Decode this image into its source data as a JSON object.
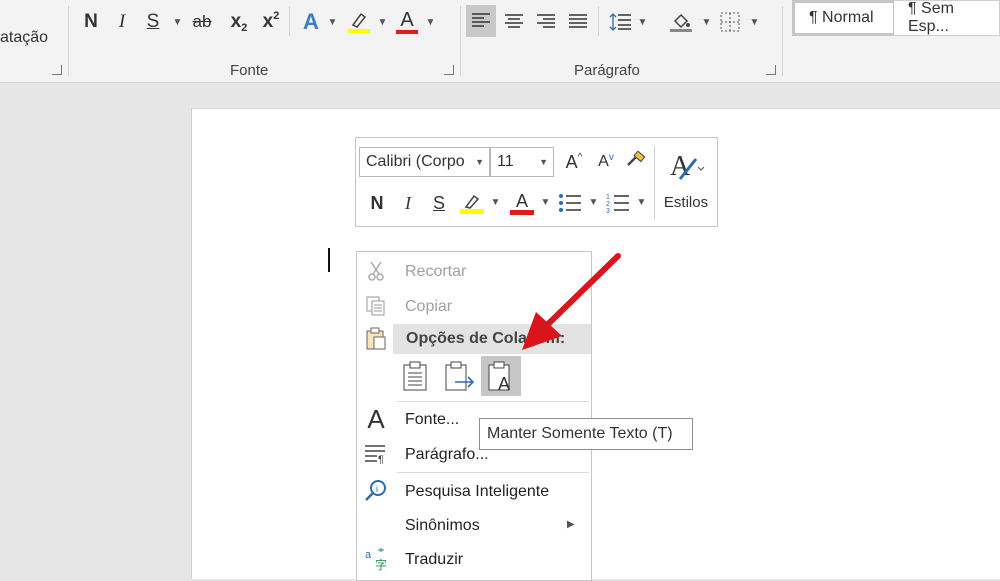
{
  "ribbon": {
    "prev_group_label": "atação",
    "font_group": {
      "label": "Fonte",
      "bold": "N",
      "italic": "I",
      "underline": "S",
      "strike": "ab",
      "subscript": "x",
      "subscript_small": "2",
      "superscript": "x",
      "superscript_small": "2",
      "text_effects": "A",
      "font_color": "A"
    },
    "paragraph_group": {
      "label": "Parágrafo"
    },
    "styles": {
      "normal": "¶ Normal",
      "no_spacing": "¶ Sem Esp..."
    }
  },
  "mini_toolbar": {
    "font_name": "Calibri (Corpo",
    "font_size": "11",
    "grow_font": "A",
    "shrink_font": "A",
    "bold": "N",
    "italic": "I",
    "underline": "S",
    "font_color": "A",
    "styles_label": "Estilos"
  },
  "context_menu": {
    "cut": "Recortar",
    "copy": "Copiar",
    "paste_options": "Opções de Colagem:",
    "font": "Fonte...",
    "paragraph": "Parágrafo...",
    "smart_lookup": "Pesquisa Inteligente",
    "synonyms": "Sinônimos",
    "translate": "Traduzir"
  },
  "tooltip": "Manter Somente Texto (T)",
  "colors": {
    "highlight": "#ffff00",
    "font_color": "#e01b1b",
    "accent": "#2b6cb0",
    "arrow": "#d9141b"
  }
}
